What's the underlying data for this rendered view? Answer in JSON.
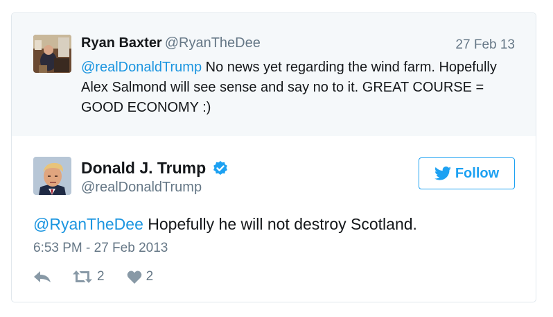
{
  "parent_tweet": {
    "author_name": "Ryan Baxter",
    "author_handle": "@RyanTheDee",
    "date": "27 Feb 13",
    "mention": "@realDonaldTrump",
    "text_after_mention": " No news yet regarding the wind farm. Hopefully Alex Salmond will see sense and say no to it. GREAT COURSE = GOOD ECONOMY :)"
  },
  "main_tweet": {
    "author_name": "Donald J. Trump",
    "author_handle": "@realDonaldTrump",
    "follow_label": "Follow",
    "mention": "@RyanTheDee",
    "text_after_mention": " Hopefully he will not destroy Scotland.",
    "timestamp": "6:53 PM - 27 Feb 2013",
    "retweet_count": "2",
    "like_count": "2"
  },
  "colors": {
    "link": "#1b95e0",
    "twitter_blue": "#1da1f2",
    "muted": "#657786",
    "parent_bg": "#f5f8fa"
  },
  "icons": [
    "verified-badge-icon",
    "twitter-bird-icon",
    "reply-icon",
    "retweet-icon",
    "heart-icon"
  ]
}
